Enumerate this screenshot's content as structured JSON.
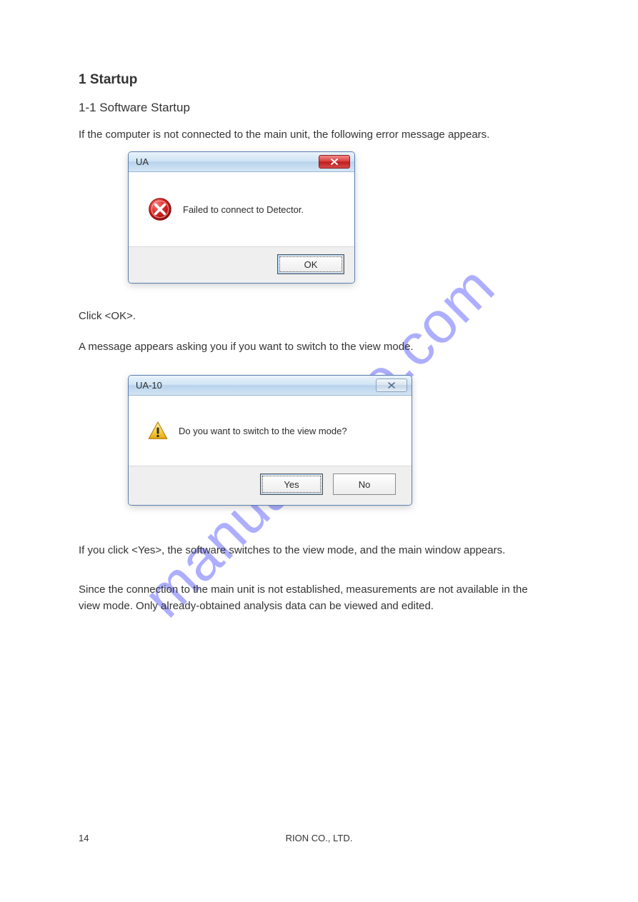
{
  "page": {
    "heading1": "1  Startup",
    "heading2": "1-1  Software Startup",
    "para1": "If the computer is not connected to the main unit, the following error message appears.",
    "para2": "Click <OK>.",
    "para3": "A message appears asking you if you want to switch to the view mode.",
    "para4": "If you click <Yes>, the software switches to the view mode, and the main window appears.",
    "para5": "Since the connection to the main unit is not established, measurements are not available in the view mode. Only already-obtained analysis data can be viewed and edited.",
    "footer_left": "14",
    "footer_center": "RION CO., LTD."
  },
  "dialog1": {
    "title": "UA",
    "message": "Failed to connect to Detector.",
    "ok_label": "OK"
  },
  "dialog2": {
    "title": "UA-10",
    "message": "Do you want to switch to the view mode?",
    "yes_label": "Yes",
    "no_label": "No"
  },
  "watermark": "manualshive.com"
}
